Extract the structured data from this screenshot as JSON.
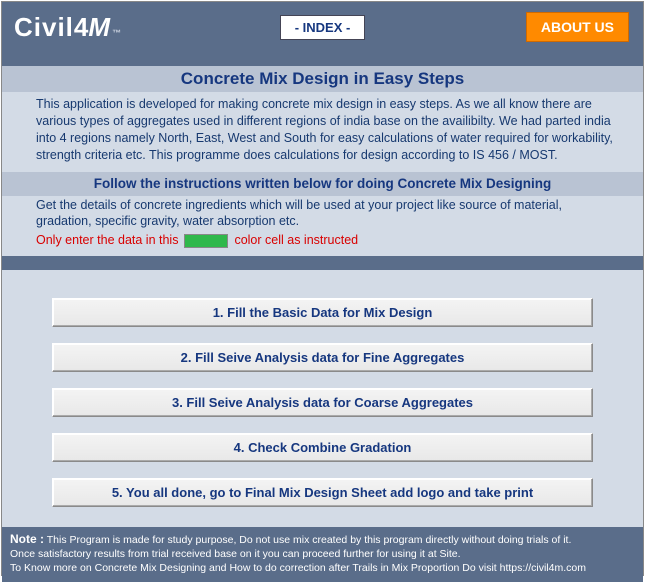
{
  "header": {
    "logo_part1": "Civil",
    "logo_part2": "4",
    "logo_part3": "M",
    "logo_tm": "™",
    "index_label": "- INDEX -",
    "about_label": "ABOUT US"
  },
  "title": "Concrete Mix Design in Easy Steps",
  "intro": "This application is developed for making concrete mix design in easy steps. As we all know there are various types of aggregates used in different regions of india base on the availibilty. We had parted india into 4 regions namely North, East, West and South for easy calculations of water required for workability, strength criteria etc. This programme does calculations for design according to IS 456 / MOST.",
  "subtitle": "Follow the instructions written below for doing Concrete Mix Designing",
  "instruct": "Get the details of concrete ingredients which will be used at your project like source of material, gradation, specific gravity, water absorption etc.",
  "instruct_red_a": "Only enter the data in this",
  "instruct_red_b": "color cell as instructed",
  "steps": [
    "1.   Fill the Basic Data for Mix Design",
    "2.   Fill Seive Analysis data for Fine Aggregates",
    "3.   Fill Seive Analysis data for Coarse Aggregates",
    "4. Check Combine Gradation",
    "5.   You all done, go to Final Mix Design Sheet add logo and take print"
  ],
  "footer": {
    "note_label": "Note :",
    "line1": " This Program is made for study purpose, Do not use mix created by this program directly without doing trials of it.",
    "line2": "Once satisfactory results from trial received base on it you can proceed further for using it at Site.",
    "line3": "To Know more on Concrete Mix Designing and How to do correction after Trails in Mix Proportion Do visit https://civil4m.com"
  }
}
